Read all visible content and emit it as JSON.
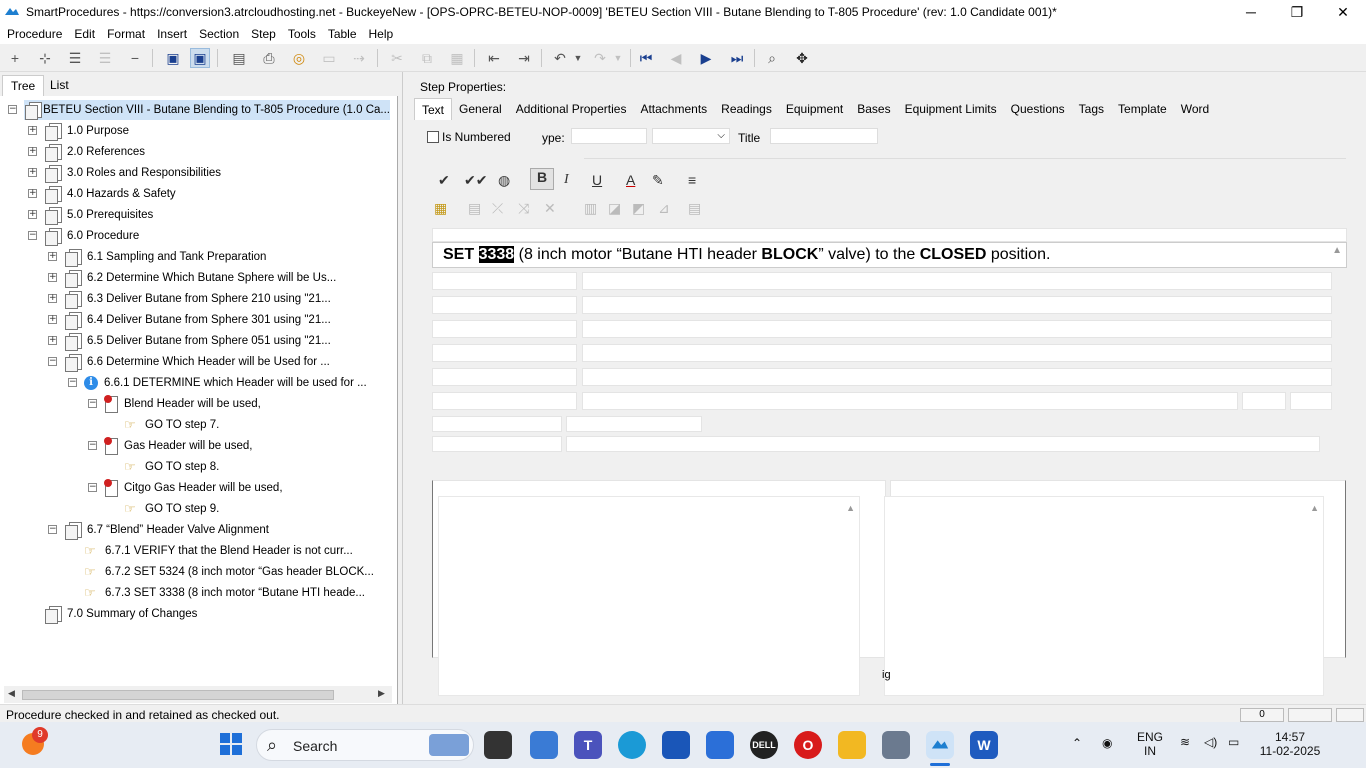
{
  "window": {
    "title": "SmartProcedures - https://conversion3.atrcloudhosting.net - BuckeyeNew - [OPS-OPRC-BETEU-NOP-0009] 'BETEU Section VIII - Butane Blending to T-805 Procedure' (rev: 1.0 Candidate 001)*",
    "minimize": "─",
    "maximize": "❐",
    "close": "✕"
  },
  "menu": [
    "Procedure",
    "Edit",
    "Format",
    "Insert",
    "Section",
    "Step",
    "Tools",
    "Table",
    "Help"
  ],
  "left_tabs": {
    "tree": "Tree",
    "list": "List"
  },
  "tree": [
    {
      "label": "BETEU Section VIII - Butane Blending to T-805 Procedure (1.0 Ca...",
      "icon": "document-icon",
      "level": 0,
      "expander": "−",
      "selected": true
    },
    {
      "label": "1.0 Purpose",
      "icon": "document-icon",
      "level": 1,
      "expander": "+"
    },
    {
      "label": "2.0 References",
      "icon": "document-icon",
      "level": 1,
      "expander": "+"
    },
    {
      "label": "3.0 Roles and Responsibilities",
      "icon": "document-icon",
      "level": 1,
      "expander": "+"
    },
    {
      "label": "4.0 Hazards & Safety",
      "icon": "document-icon",
      "level": 1,
      "expander": "+"
    },
    {
      "label": "5.0 Prerequisites",
      "icon": "document-icon",
      "level": 1,
      "expander": "+"
    },
    {
      "label": "6.0 Procedure",
      "icon": "document-icon",
      "level": 1,
      "expander": "−"
    },
    {
      "label": "6.1 Sampling and Tank Preparation",
      "icon": "document-icon",
      "level": 2,
      "expander": "+"
    },
    {
      "label": "6.2 Determine Which Butane Sphere will be Us...",
      "icon": "document-icon",
      "level": 2,
      "expander": "+"
    },
    {
      "label": "6.3 Deliver Butane from Sphere 210 using \"21...",
      "icon": "document-icon",
      "level": 2,
      "expander": "+"
    },
    {
      "label": "6.4 Deliver Butane from Sphere 301 using \"21...",
      "icon": "document-icon",
      "level": 2,
      "expander": "+"
    },
    {
      "label": "6.5 Deliver Butane from Sphere 051 using \"21...",
      "icon": "document-icon",
      "level": 2,
      "expander": "+"
    },
    {
      "label": "6.6 Determine Which Header will be Used for ...",
      "icon": "document-icon",
      "level": 2,
      "expander": "−"
    },
    {
      "label": "6.6.1 DETERMINE which Header will be used for ...",
      "icon": "info-icon",
      "level": 3,
      "expander": "−"
    },
    {
      "label": "Blend Header will be used,",
      "icon": "condition-icon",
      "level": 4,
      "expander": "−"
    },
    {
      "label": "GO TO step 7.",
      "icon": "hand-icon",
      "level": 5,
      "expander": ""
    },
    {
      "label": "Gas Header will be used,",
      "icon": "condition-icon",
      "level": 4,
      "expander": "−"
    },
    {
      "label": "GO TO step 8.",
      "icon": "hand-icon",
      "level": 5,
      "expander": ""
    },
    {
      "label": "Citgo Gas Header will be used,",
      "icon": "condition-icon",
      "level": 4,
      "expander": "−"
    },
    {
      "label": "GO TO step 9.",
      "icon": "hand-icon",
      "level": 5,
      "expander": ""
    },
    {
      "label": "6.7 “Blend” Header Valve Alignment",
      "icon": "document-icon",
      "level": 2,
      "expander": "−"
    },
    {
      "label": "6.7.1 VERIFY that the Blend Header is not curr...",
      "icon": "hand-icon",
      "level": 3,
      "expander": ""
    },
    {
      "label": "6.7.2 SET 5324 (8 inch motor “Gas header BLOCK...",
      "icon": "hand-icon",
      "level": 3,
      "expander": ""
    },
    {
      "label": "6.7.3 SET 3338 (8 inch motor “Butane HTI heade...",
      "icon": "hand-icon",
      "level": 3,
      "expander": ""
    },
    {
      "label": "7.0 Summary of Changes",
      "icon": "document-icon",
      "level": 1,
      "expander": ""
    }
  ],
  "right": {
    "step_properties_label": "Step Properties:",
    "tabs": [
      "Text",
      "General",
      "Additional Properties",
      "Attachments",
      "Readings",
      "Equipment",
      "Bases",
      "Equipment Limits",
      "Questions",
      "Tags",
      "Template",
      "Word"
    ],
    "is_numbered_label": "Is Numbered",
    "type_label": "ype:",
    "title_label": "Title",
    "dropdown_arrow": "⌵",
    "step_text": {
      "w1": "SET",
      "w2": "3338",
      "w3": "(8 inch motor “Butane HTI header",
      "w4": "BLOCK",
      "w5": "” valve) to the",
      "w6": "CLOSED",
      "w7": "position."
    },
    "side_label": "ig"
  },
  "status": {
    "message": "Procedure checked in and retained as checked out.",
    "cell1": "0"
  },
  "taskbar": {
    "search_label": "Search",
    "notification_count": "9",
    "lang_line1": "ENG",
    "lang_line2": "IN",
    "time": "14:57",
    "date": "11-02-2025"
  },
  "colors": {
    "selection": "#cfe3f7",
    "accent": "#1a3f8f",
    "taskbar": "#e7ecf3"
  }
}
